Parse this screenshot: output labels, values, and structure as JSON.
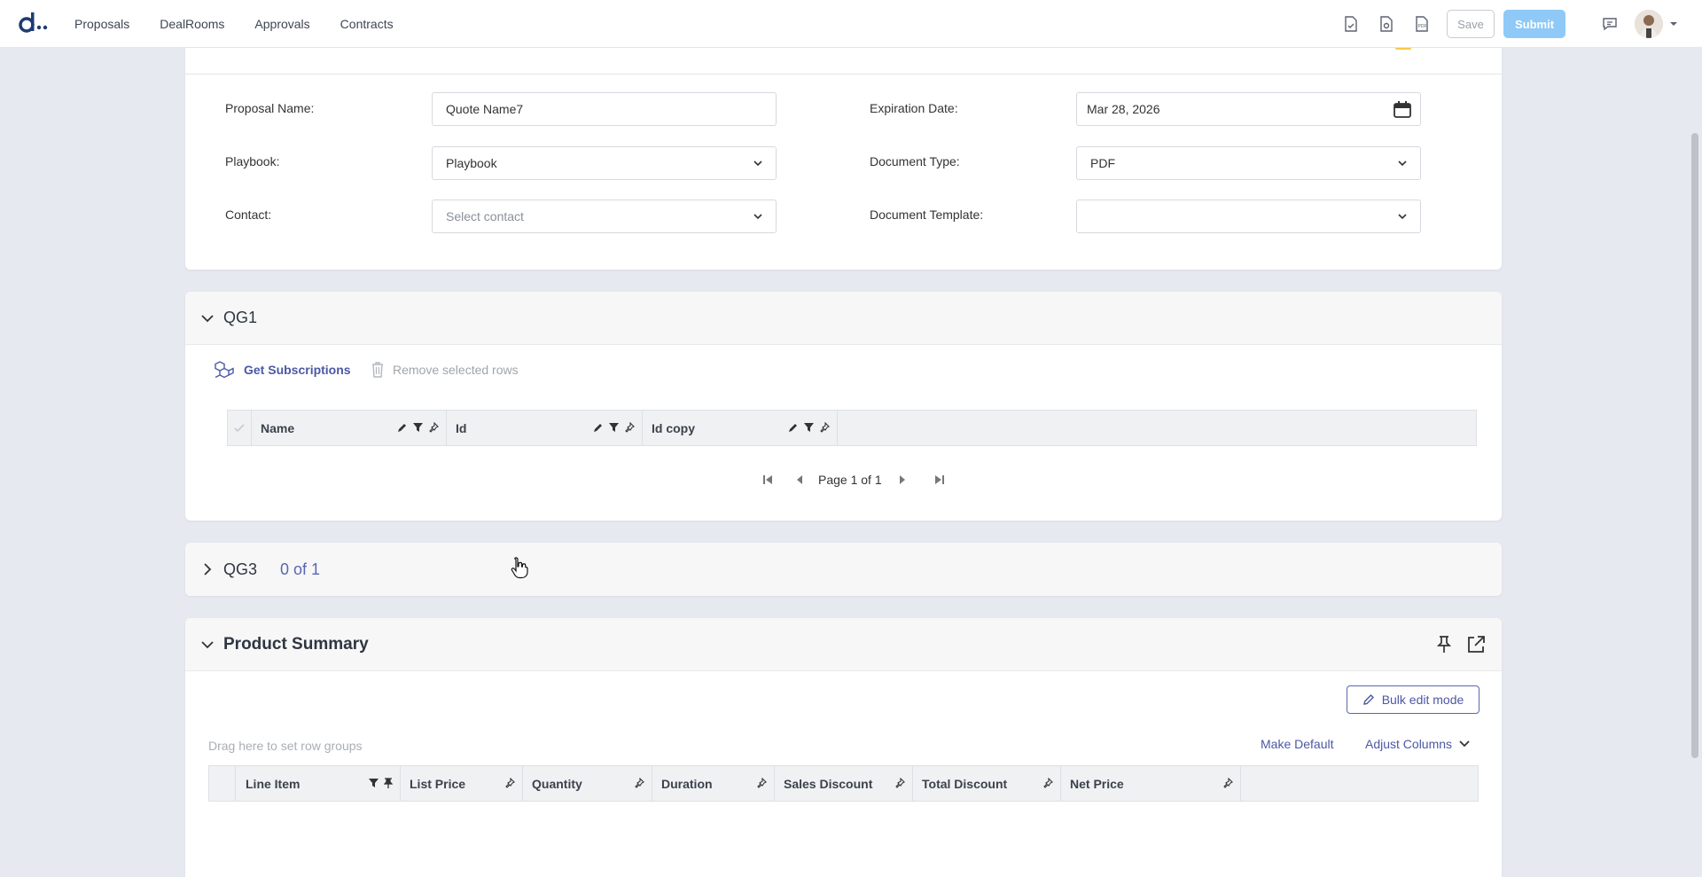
{
  "nav": {
    "items": [
      "Proposals",
      "DealRooms",
      "Approvals",
      "Contracts"
    ]
  },
  "toolbar": {
    "save_label": "Save",
    "submit_label": "Submit"
  },
  "form": {
    "proposal_name_label": "Proposal Name:",
    "proposal_name_value": "Quote Name7",
    "playbook_label": "Playbook:",
    "playbook_value": "Playbook",
    "contact_label": "Contact:",
    "contact_placeholder": "Select contact",
    "expiration_label": "Expiration Date:",
    "expiration_value": "Mar 28, 2026",
    "doc_type_label": "Document Type:",
    "doc_type_value": "PDF",
    "doc_template_label": "Document Template:",
    "doc_template_value": ""
  },
  "qg1": {
    "title": "QG1",
    "get_subscriptions": "Get Subscriptions",
    "remove_rows": "Remove selected rows",
    "columns": [
      "Name",
      "Id",
      "Id copy"
    ],
    "pager_text": "Page 1 of 1"
  },
  "qg3": {
    "title": "QG3",
    "counter": "0 of 1"
  },
  "product_summary": {
    "title": "Product Summary",
    "bulk_edit": "Bulk edit mode",
    "drag_hint": "Drag here to set row groups",
    "make_default": "Make Default",
    "adjust_columns": "Adjust Columns",
    "columns": [
      "Line Item",
      "List Price",
      "Quantity",
      "Duration",
      "Sales Discount",
      "Total Discount",
      "Net Price"
    ]
  },
  "colors": {
    "accent": "#4b58a4",
    "submit_bg": "#8ec9f7",
    "page_bg": "#e6eaf0"
  }
}
